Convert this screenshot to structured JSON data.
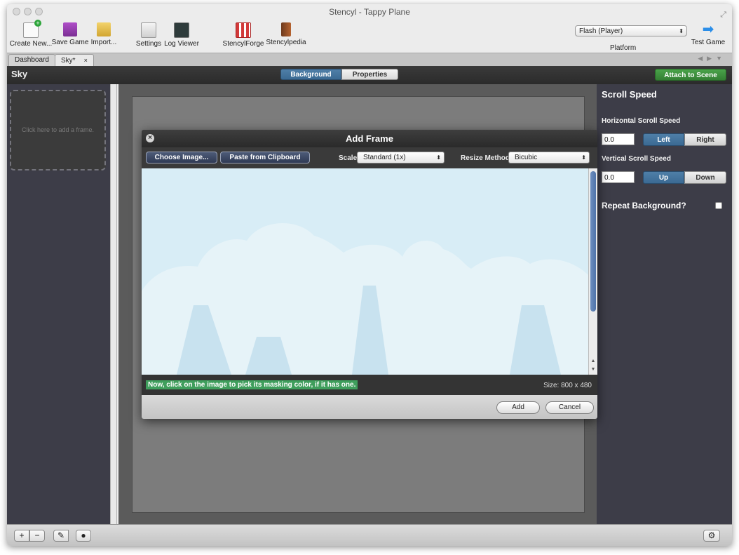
{
  "window": {
    "title": "Stencyl - Tappy Plane"
  },
  "toolbar": {
    "create_new": "Create New...",
    "save_game": "Save Game",
    "import": "Import...",
    "settings": "Settings",
    "log_viewer": "Log Viewer",
    "stencylforge": "StencylForge",
    "stencylpedia": "Stencylpedia",
    "platform_value": "Flash (Player)",
    "platform_label": "Platform",
    "test_game": "Test Game"
  },
  "tabs": [
    {
      "label": "Dashboard",
      "active": false
    },
    {
      "label": "Sky*",
      "active": true
    }
  ],
  "tab_close": "×",
  "header": {
    "title": "Sky",
    "seg_background": "Background",
    "seg_properties": "Properties",
    "attach": "Attach to Scene"
  },
  "left_panel": {
    "frame_slot_text": "Click here to add a frame."
  },
  "right_panel": {
    "title": "Scroll Speed",
    "h_label": "Horizontal Scroll Speed",
    "h_value": "0.0",
    "h_left": "Left",
    "h_right": "Right",
    "v_label": "Vertical Scroll Speed",
    "v_value": "0.0",
    "v_up": "Up",
    "v_down": "Down",
    "repeat_label": "Repeat Background?",
    "repeat_checked": false
  },
  "dialog": {
    "title": "Add Frame",
    "choose_image": "Choose Image...",
    "paste_clipboard": "Paste from Clipboard",
    "scale_label": "Scale",
    "scale_value": "Standard (1x)",
    "resize_label": "Resize Method",
    "resize_value": "Bicubic",
    "mask_hint": "Now, click on the image to pick its masking color, if it has one.",
    "size": "Size: 800 x 480",
    "add": "Add",
    "cancel": "Cancel"
  },
  "bottom_bar": {
    "add": "+",
    "remove": "−"
  },
  "colors": {
    "accent_blue": "#3b6a93",
    "attach_green": "#347f34",
    "hint_green": "#3f9e5c",
    "sky": "#d8edf6"
  },
  "icons": [
    "create-new-icon",
    "save-game-icon",
    "import-icon",
    "settings-icon",
    "log-viewer-icon",
    "stencylforge-icon",
    "stencylpedia-icon",
    "test-game-icon",
    "pencil-icon",
    "record-icon",
    "gear-icon"
  ]
}
